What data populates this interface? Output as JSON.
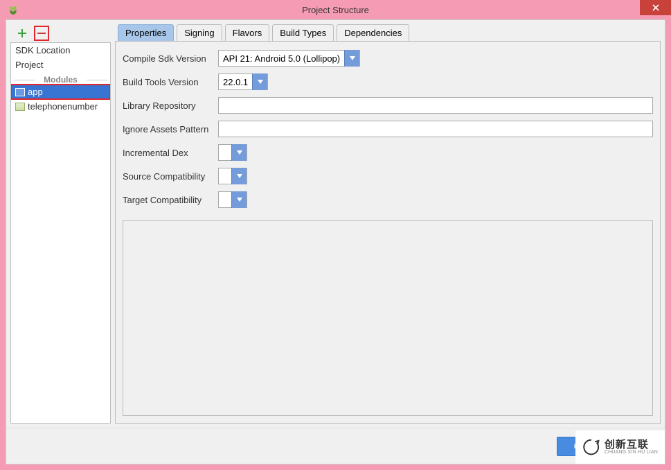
{
  "window": {
    "title": "Project Structure"
  },
  "sidebar": {
    "items": [
      {
        "label": "SDK Location"
      },
      {
        "label": "Project"
      }
    ],
    "section": "Modules",
    "modules": [
      {
        "label": "app",
        "selected": true
      },
      {
        "label": "telephonenumber",
        "selected": false
      }
    ]
  },
  "tabs": [
    {
      "label": "Properties",
      "active": true
    },
    {
      "label": "Signing",
      "active": false
    },
    {
      "label": "Flavors",
      "active": false
    },
    {
      "label": "Build Types",
      "active": false
    },
    {
      "label": "Dependencies",
      "active": false
    }
  ],
  "form": {
    "compile_sdk": {
      "label": "Compile Sdk Version",
      "value": "API 21: Android 5.0 (Lollipop)"
    },
    "build_tools": {
      "label": "Build Tools Version",
      "value": "22.0.1"
    },
    "library_repo": {
      "label": "Library Repository",
      "value": ""
    },
    "ignore_assets": {
      "label": "Ignore Assets Pattern",
      "value": ""
    },
    "incremental_dex": {
      "label": "Incremental Dex",
      "value": ""
    },
    "source_compat": {
      "label": "Source Compatibility",
      "value": ""
    },
    "target_compat": {
      "label": "Target Compatibility",
      "value": ""
    }
  },
  "footer": {
    "ok": "OK"
  },
  "watermark": {
    "cn": "创新互联",
    "en": "CHUANG XIN HU LIAN"
  }
}
